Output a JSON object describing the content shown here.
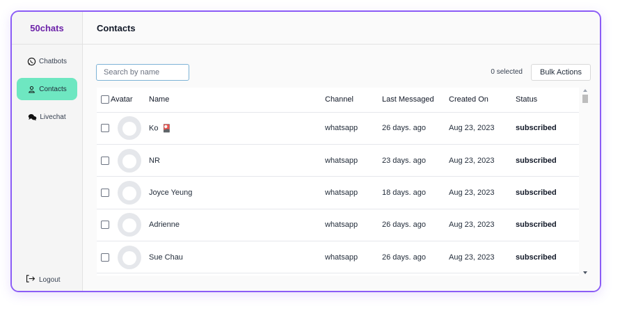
{
  "brand": "50chats",
  "sidebar": {
    "items": [
      {
        "label": "Chatbots",
        "icon": "whatsapp-icon",
        "active": false
      },
      {
        "label": "Contacts",
        "icon": "user-icon",
        "active": true
      },
      {
        "label": "Livechat",
        "icon": "chat-bubbles-icon",
        "active": false
      }
    ],
    "logout": {
      "label": "Logout",
      "icon": "logout-icon"
    }
  },
  "header": {
    "title": "Contacts"
  },
  "toolbar": {
    "search_placeholder": "Search by name",
    "selected_count": "0 selected",
    "bulk_actions_label": "Bulk Actions"
  },
  "table": {
    "columns": [
      "Avatar",
      "Name",
      "Channel",
      "Last Messaged",
      "Created On",
      "Status"
    ],
    "rows": [
      {
        "name": "Ko",
        "emoji": "🎴",
        "channel": "whatsapp",
        "last_messaged": "26 days. ago",
        "created_on": "Aug 23, 2023",
        "status": "subscribed"
      },
      {
        "name": "NR",
        "emoji": "",
        "channel": "whatsapp",
        "last_messaged": "23 days. ago",
        "created_on": "Aug 23, 2023",
        "status": "subscribed"
      },
      {
        "name": "Joyce Yeung",
        "emoji": "",
        "channel": "whatsapp",
        "last_messaged": "18 days. ago",
        "created_on": "Aug 23, 2023",
        "status": "subscribed"
      },
      {
        "name": "Adrienne",
        "emoji": "",
        "channel": "whatsapp",
        "last_messaged": "26 days. ago",
        "created_on": "Aug 23, 2023",
        "status": "subscribed"
      },
      {
        "name": "Sue Chau",
        "emoji": "",
        "channel": "whatsapp",
        "last_messaged": "26 days. ago",
        "created_on": "Aug 23, 2023",
        "status": "subscribed"
      }
    ]
  },
  "colors": {
    "frame_border": "#8b5cf6",
    "brand_text": "#6b21a8",
    "active_nav": "#6ee7c1"
  }
}
